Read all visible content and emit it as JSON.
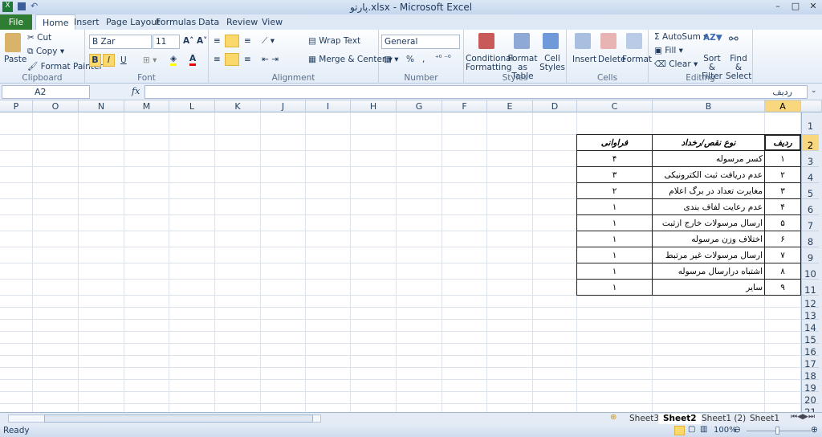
{
  "window": {
    "title": "پارتو.xlsx - Microsoft Excel",
    "controls": [
      "minimize",
      "maximize",
      "close"
    ]
  },
  "tabs": [
    "File",
    "Home",
    "Insert",
    "Page Layout",
    "Formulas",
    "Data",
    "Review",
    "View"
  ],
  "ribbon": {
    "clipboard": {
      "paste": "Paste",
      "cut": "Cut",
      "copy": "Copy",
      "format_painter": "Format Painter",
      "label": "Clipboard"
    },
    "font": {
      "name": "B Zar",
      "size": "11",
      "bold": "B",
      "italic": "I",
      "underline": "U",
      "label": "Font"
    },
    "alignment": {
      "wrap": "Wrap Text",
      "merge": "Merge & Center",
      "label": "Alignment"
    },
    "number": {
      "format": "General",
      "percent": "%",
      "comma": ",",
      "label": "Number"
    },
    "styles": {
      "conditional": "Conditional Formatting",
      "format_table": "Format as Table",
      "cell_styles": "Cell Styles",
      "label": "Styles"
    },
    "cells": {
      "insert": "Insert",
      "delete": "Delete",
      "format": "Format",
      "label": "Cells"
    },
    "editing": {
      "autosum": "AutoSum",
      "fill": "Fill",
      "clear": "Clear",
      "sort": "Sort & Filter",
      "find": "Find & Select",
      "label": "Editing"
    }
  },
  "formula_bar": {
    "name_box": "A2",
    "fx": "fx",
    "value": "ردیف"
  },
  "columns": [
    "A",
    "B",
    "C",
    "D",
    "E",
    "F",
    "G",
    "H",
    "I",
    "J",
    "K",
    "L",
    "M",
    "N",
    "O",
    "P"
  ],
  "rows": [
    "1",
    "2",
    "3",
    "4",
    "5",
    "6",
    "7",
    "8",
    "9",
    "10",
    "11",
    "12",
    "13",
    "14",
    "15",
    "16",
    "17",
    "18",
    "19",
    "20",
    "21"
  ],
  "table": {
    "headers": [
      "ردیف",
      "نوع نقص/رخداد",
      "فراوانی"
    ],
    "rows": [
      [
        "۱",
        "کسر مرسوله",
        "۴"
      ],
      [
        "۲",
        "عدم دریافت ثبت الکترونیکی",
        "۳"
      ],
      [
        "۳",
        "مغایرت تعداد در برگ اعلام",
        "۲"
      ],
      [
        "۴",
        "عدم رعایت لفاف بندی",
        "۱"
      ],
      [
        "۵",
        "ارسال مرسولات خارج ازثبت",
        "۱"
      ],
      [
        "۶",
        "اختلاف وزن مرسوله",
        "۱"
      ],
      [
        "۷",
        "ارسال مرسولات  غیر مرتبط",
        "۱"
      ],
      [
        "۸",
        "اشتباه درارسال مرسوله",
        "۱"
      ],
      [
        "۹",
        "سایر",
        "۱"
      ]
    ]
  },
  "sheet_tabs": [
    "Sheet3",
    "Sheet2",
    "Sheet1 (2)",
    "Sheet1"
  ],
  "active_sheet": "Sheet2",
  "status": {
    "ready": "Ready",
    "zoom": "100%"
  }
}
